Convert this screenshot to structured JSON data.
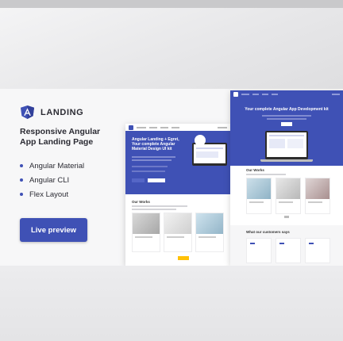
{
  "brand": {
    "name": "LANDING",
    "logo_icon": "angular-logo-icon"
  },
  "headline": {
    "line1": "Responsive Angular",
    "line2": "App Landing Page"
  },
  "features": [
    "Angular Material",
    "Angular CLI",
    "Flex Layout"
  ],
  "preview_button": {
    "label": "Live preview"
  },
  "colors": {
    "accent": "#3f51b5",
    "text": "#2b2b33"
  },
  "mockup_small": {
    "hero_title": [
      "Angular Landing + Egret,",
      "Your complete Angular",
      "Material Design UI kit"
    ],
    "section_title": "Our Works"
  },
  "mockup_large": {
    "hero_title": "Your complete Angular App Development kit",
    "section_title": "Our Works",
    "testimonials_title": "What our customers says"
  }
}
